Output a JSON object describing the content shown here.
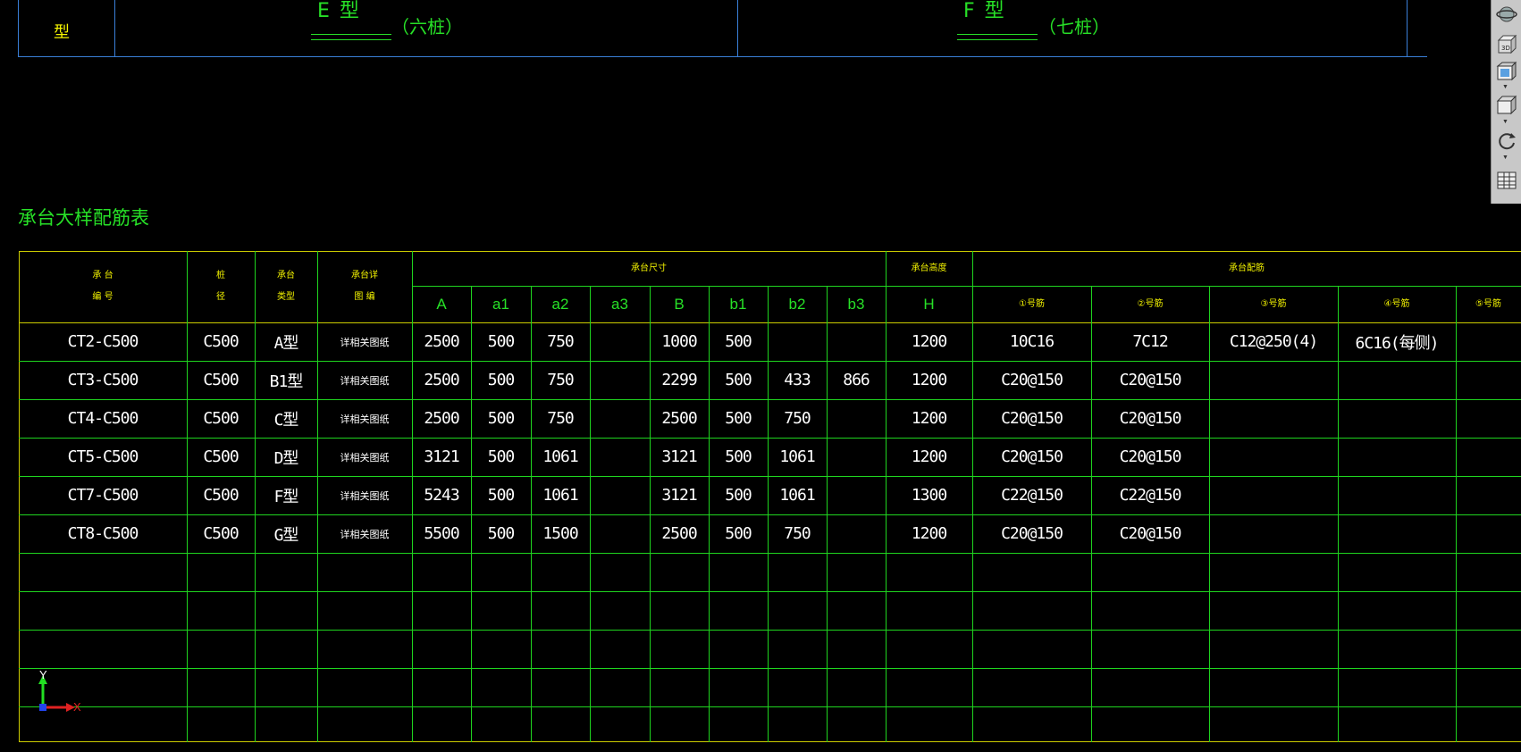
{
  "top_drawing": {
    "left_label": "型",
    "type_e": "E 型",
    "type_e_piles": "（六桩）",
    "type_f": "F 型",
    "type_f_piles": "（七桩）"
  },
  "table": {
    "caption": "承台大样配筋表",
    "headers": {
      "code_line1": "承 台",
      "code_line2": "编 号",
      "concrete_line1": "桩",
      "concrete_line2": "径",
      "type_line1": "承台",
      "type_line2": "类型",
      "detail_line1": "承台详",
      "detail_line2": "图 编",
      "size_group": "承台尺寸",
      "height_group": "承台高度",
      "rebar_group": "承台配筋",
      "dims": [
        "A",
        "a1",
        "a2",
        "a3",
        "B",
        "b1",
        "b2",
        "b3",
        "H"
      ],
      "rebar_cols": [
        "①号筋",
        "②号筋",
        "③号筋",
        "④号筋",
        "⑤号筋"
      ]
    },
    "rows": [
      {
        "code": "CT2-C500",
        "pile": "C500",
        "type": "A型",
        "detail": "详相关图纸",
        "A": "2500",
        "a1": "500",
        "a2": "750",
        "a3": "",
        "B": "1000",
        "b1": "500",
        "b2": "",
        "b3": "",
        "H": "1200",
        "r1": "10C16",
        "r2": "7C12",
        "r3": "C12@250(4)",
        "r4": "6C16(每侧)",
        "r5": ""
      },
      {
        "code": "CT3-C500",
        "pile": "C500",
        "type": "B1型",
        "detail": "详相关图纸",
        "A": "2500",
        "a1": "500",
        "a2": "750",
        "a3": "",
        "B": "2299",
        "b1": "500",
        "b2": "433",
        "b3": "866",
        "H": "1200",
        "r1": "C20@150",
        "r2": "C20@150",
        "r3": "",
        "r4": "",
        "r5": ""
      },
      {
        "code": "CT4-C500",
        "pile": "C500",
        "type": "C型",
        "detail": "详相关图纸",
        "A": "2500",
        "a1": "500",
        "a2": "750",
        "a3": "",
        "B": "2500",
        "b1": "500",
        "b2": "750",
        "b3": "",
        "H": "1200",
        "r1": "C20@150",
        "r2": "C20@150",
        "r3": "",
        "r4": "",
        "r5": ""
      },
      {
        "code": "CT5-C500",
        "pile": "C500",
        "type": "D型",
        "detail": "详相关图纸",
        "A": "3121",
        "a1": "500",
        "a2": "1061",
        "a3": "",
        "B": "3121",
        "b1": "500",
        "b2": "1061",
        "b3": "",
        "H": "1200",
        "r1": "C20@150",
        "r2": "C20@150",
        "r3": "",
        "r4": "",
        "r5": ""
      },
      {
        "code": "CT7-C500",
        "pile": "C500",
        "type": "F型",
        "detail": "详相关图纸",
        "A": "5243",
        "a1": "500",
        "a2": "1061",
        "a3": "",
        "B": "3121",
        "b1": "500",
        "b2": "1061",
        "b3": "",
        "H": "1300",
        "r1": "C22@150",
        "r2": "C22@150",
        "r3": "",
        "r4": "",
        "r5": ""
      },
      {
        "code": "CT8-C500",
        "pile": "C500",
        "type": "G型",
        "detail": "详相关图纸",
        "A": "5500",
        "a1": "500",
        "a2": "1500",
        "a3": "",
        "B": "2500",
        "b1": "500",
        "b2": "750",
        "b3": "",
        "H": "1200",
        "r1": "C20@150",
        "r2": "C20@150",
        "r3": "",
        "r4": "",
        "r5": ""
      }
    ]
  },
  "ucs": {
    "x_label": "X",
    "y_label": "Y"
  },
  "toolbar": {
    "buttons": [
      {
        "name": "orbit-globe-icon"
      },
      {
        "name": "view-3d-icon",
        "label": "3D"
      },
      {
        "name": "view-cube-front-icon"
      },
      {
        "name": "view-cube-iso-icon"
      },
      {
        "name": "refresh-orbit-icon"
      },
      {
        "name": "named-views-icon"
      }
    ]
  }
}
